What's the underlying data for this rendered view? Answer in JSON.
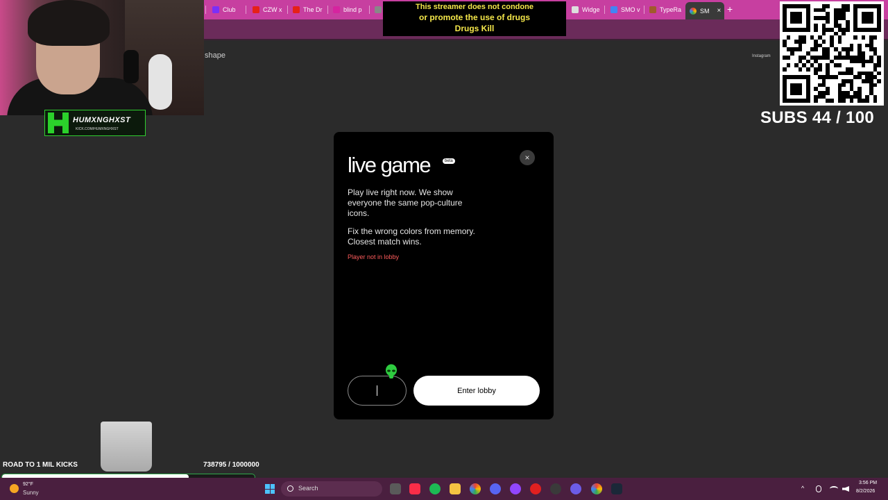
{
  "browser": {
    "tabs": [
      {
        "label": "Club",
        "color": "#7b2ff7"
      },
      {
        "label": "CZW x",
        "color": "#e62117"
      },
      {
        "label": "The Dr",
        "color": "#e62117"
      },
      {
        "label": "blind p",
        "color": "#d6249f"
      },
      {
        "label": "Widge",
        "color": "#333333"
      },
      {
        "label": "SMO v",
        "color": "#4285f4"
      },
      {
        "label": "TypeRa",
        "color": "#a05a2c"
      },
      {
        "label": "SM",
        "color": "#ea4335",
        "active": true
      }
    ],
    "new_tab_label": "+"
  },
  "site": {
    "logo_text": "shape",
    "instagram_link": "Instagram"
  },
  "overlay": {
    "streamer_name": "HUMXNGHXST",
    "streamer_url": "KICK.COM/HUMXNGHXST",
    "disclaimer": {
      "line1": "This streamer does not condone",
      "line2": "or promote the use of drugs",
      "line3": "Drugs Kill"
    },
    "subs_goal": "SUBS 44 / 100",
    "road_label": "ROAD TO 1 MIL KICKS",
    "road_count": "738795 / 1000000",
    "road_progress": 0.7388
  },
  "modal": {
    "title": "live game",
    "badge": "beta",
    "close_label": "×",
    "description1": "Play live right now. We show everyone the same pop-culture icons.",
    "description2": "Fix the wrong colors from memory. Closest match wins.",
    "status_message": "Player not in lobby",
    "name_input_value": "",
    "avatar_icon": "alien-icon",
    "enter_button": "Enter lobby"
  },
  "taskbar": {
    "weather_temp": "92°F",
    "weather_condition": "Sunny",
    "search_placeholder": "Search",
    "clock_time": "3:56 PM",
    "clock_date": "8/2/2026",
    "tray_chevron": "^"
  },
  "colors": {
    "accent_pink": "#c73fa0",
    "warn_red": "#ff5c5c",
    "kick_green": "#2fd02f"
  }
}
